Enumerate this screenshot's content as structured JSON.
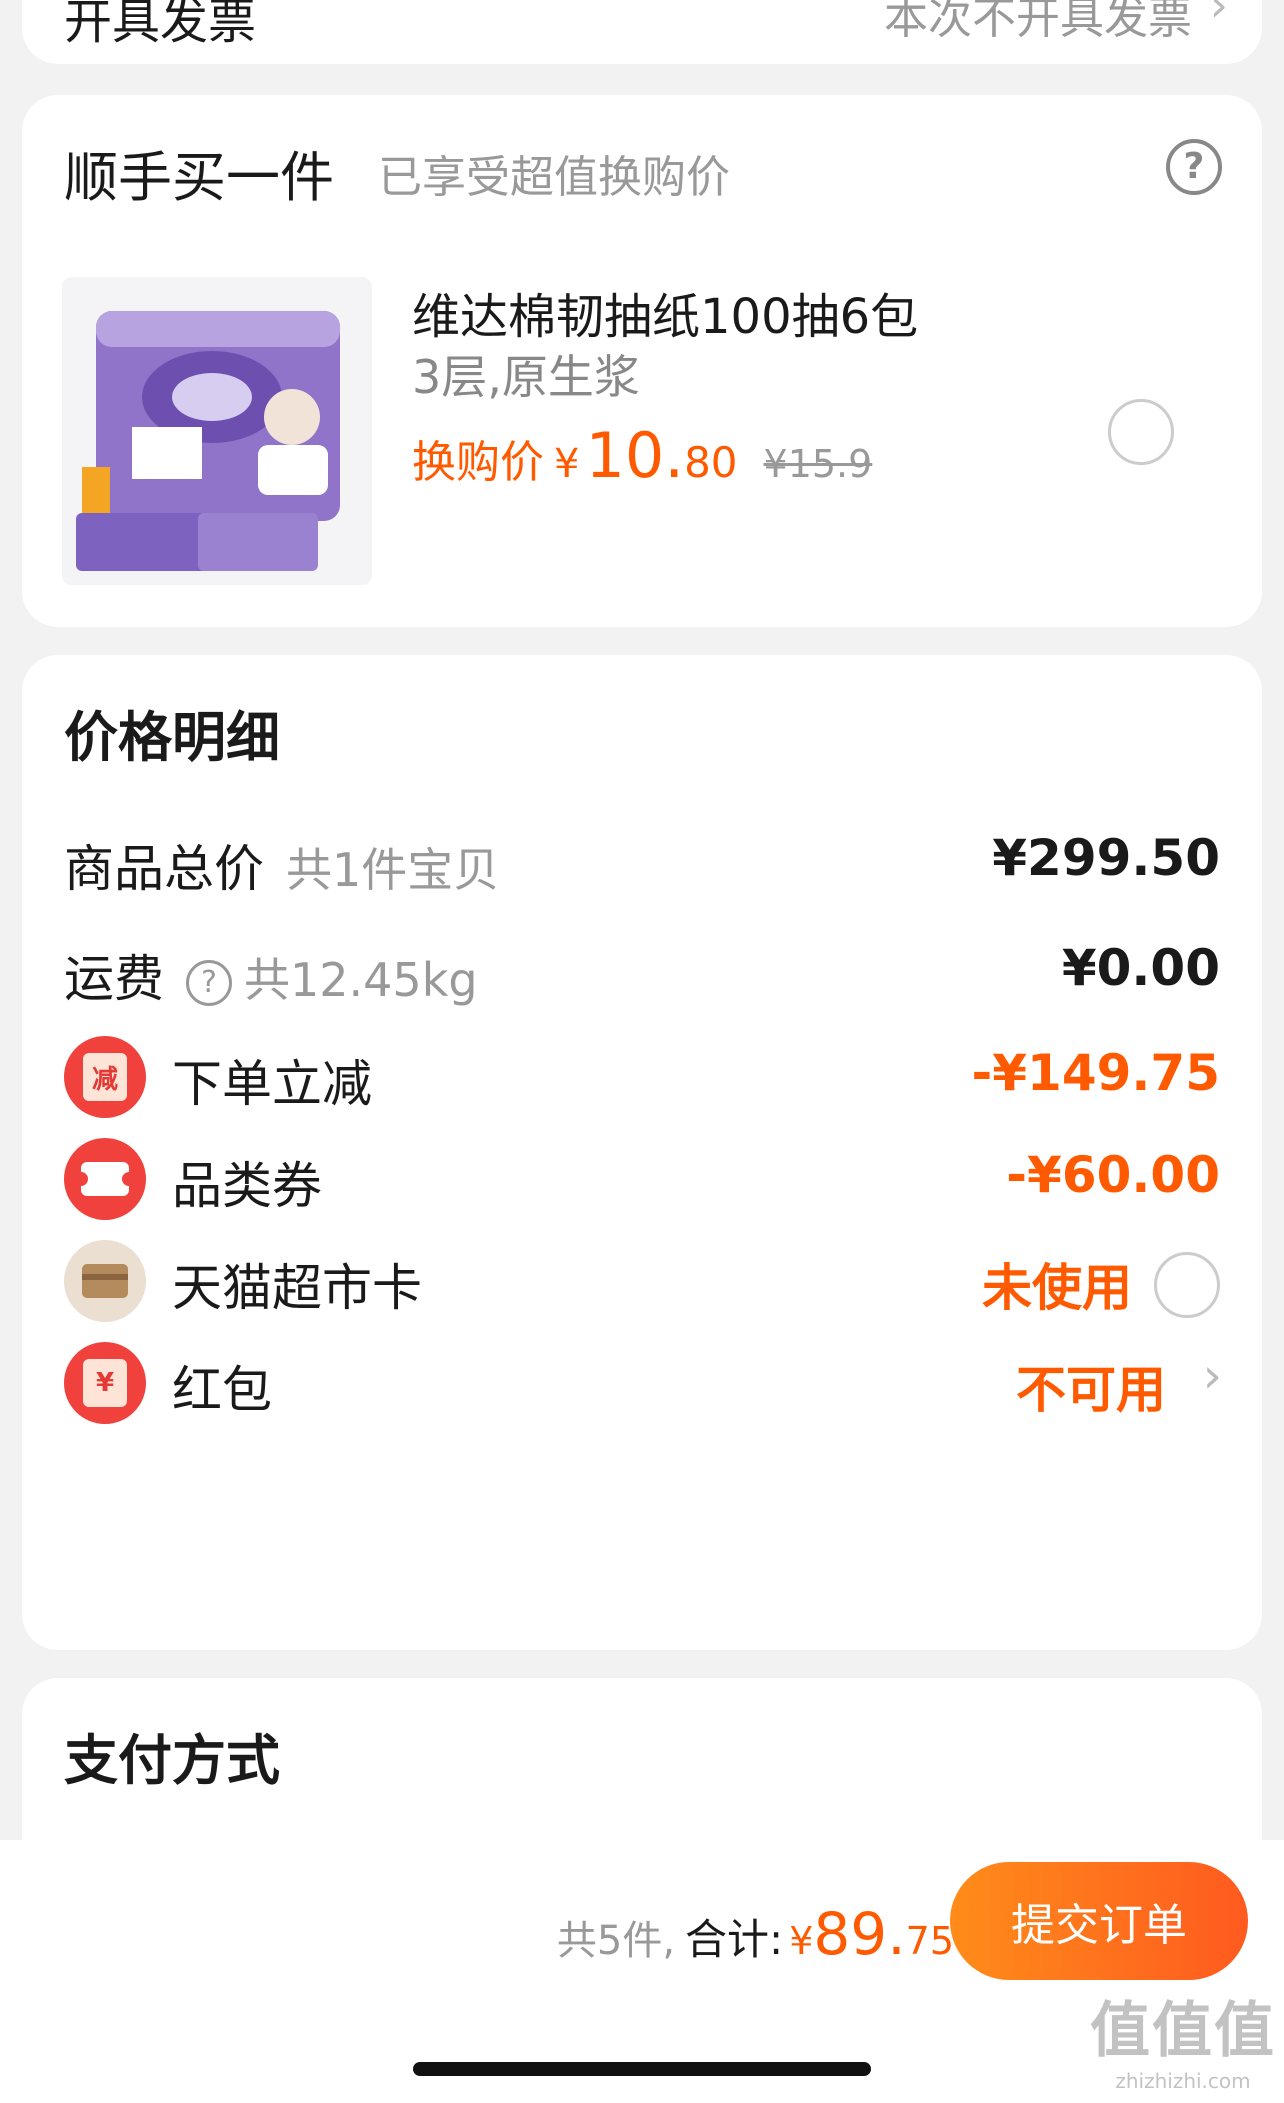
{
  "invoice": {
    "label": "开具发票",
    "value": "本次不开具发票"
  },
  "addon": {
    "title": "顺手买一件",
    "subtitle": "已享受超值换购价",
    "product": {
      "name": "维达棉韧抽纸100抽6包",
      "spec": "3层,原生浆",
      "price_label": "换购价",
      "currency": "¥",
      "price_int": "10.",
      "price_dec": "80",
      "original_price": "¥15.9"
    }
  },
  "price_detail": {
    "title": "价格明细",
    "items": [
      {
        "label": "商品总价",
        "sub": "共1件宝贝",
        "value": "¥299.50"
      },
      {
        "label": "运费",
        "sub": "共12.45kg",
        "value": "¥0.00"
      },
      {
        "label": "下单立减",
        "value": "-¥149.75",
        "icon": "discount-badge-icon",
        "badge": "减"
      },
      {
        "label": "品类券",
        "value": "-¥60.00",
        "icon": "coupon-icon"
      },
      {
        "label": "天猫超市卡",
        "value": "未使用",
        "icon": "card-icon"
      },
      {
        "label": "红包",
        "value": "不可用",
        "icon": "red-envelope-icon",
        "badge": "¥"
      }
    ]
  },
  "payment": {
    "title": "支付方式"
  },
  "bottom_bar": {
    "count": "共5件,",
    "total_label": "合计:",
    "currency": "¥",
    "total_int": "89.",
    "total_dec": "75",
    "submit_label": "提交订单"
  },
  "colors": {
    "accent": "#ff5a00",
    "button_start": "#ff8c1a",
    "button_end": "#ff5a1f",
    "icon_red": "#f0413c"
  },
  "watermark": {
    "line1": "值值值",
    "line2": "zhizhizhi.com"
  }
}
